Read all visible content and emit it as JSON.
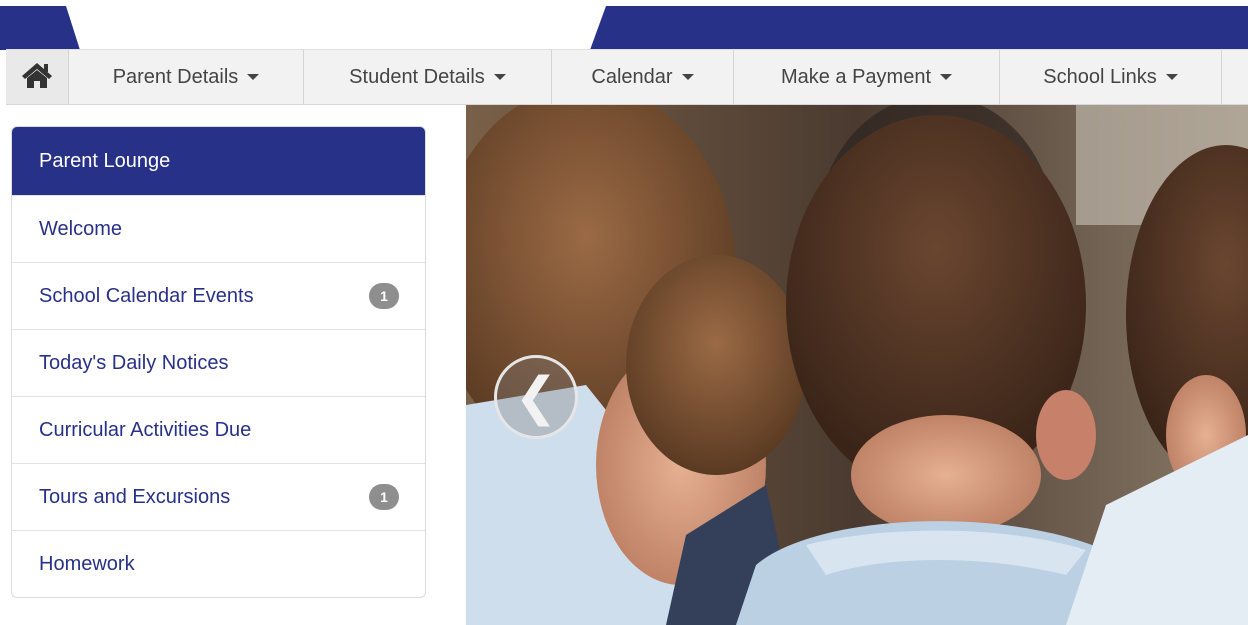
{
  "nav": {
    "home_icon": "home-icon",
    "items": [
      {
        "label": "Parent Details"
      },
      {
        "label": "Student Details"
      },
      {
        "label": "Calendar"
      },
      {
        "label": "Make a Payment"
      },
      {
        "label": "School Links"
      }
    ]
  },
  "sidebar": {
    "title": "Parent Lounge",
    "items": [
      {
        "label": "Welcome",
        "badge": ""
      },
      {
        "label": "School Calendar Events",
        "badge": "1"
      },
      {
        "label": "Today's Daily Notices",
        "badge": ""
      },
      {
        "label": "Curricular Activities Due",
        "badge": ""
      },
      {
        "label": "Tours and Excursions",
        "badge": "1"
      },
      {
        "label": "Homework",
        "badge": ""
      }
    ]
  },
  "carousel": {
    "prev_glyph": "❮",
    "prev_icon": "chevron-left-icon"
  },
  "colors": {
    "brand_navy": "#283188",
    "badge_grey": "#8e8e8e",
    "link_navy": "#283188"
  }
}
